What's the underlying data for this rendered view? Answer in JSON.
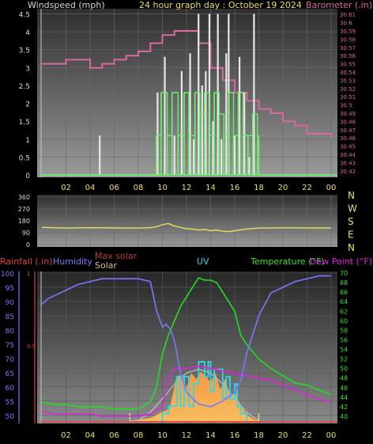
{
  "chart_data": [
    {
      "type": "line",
      "title": "24 hour graph day : October 19 2024",
      "y_left_label": "Windspeed (mph)",
      "y_right_label": "Barometer (.in)",
      "x_ticks": [
        "02",
        "04",
        "06",
        "08",
        "10",
        "12",
        "14",
        "16",
        "18",
        "20",
        "22",
        "00"
      ],
      "y_left_ticks": [
        "0",
        "0.5",
        "1",
        "1.5",
        "2",
        "2.5",
        "3",
        "3.5",
        "4",
        "4.5"
      ],
      "y_right_ticks": [
        "30.42",
        "30.43",
        "30.44",
        "30.45",
        "30.46",
        "30.47",
        "30.48",
        "30.49",
        "30.5",
        "30.51",
        "30.52",
        "30.53",
        "30.54",
        "30.55",
        "30.56",
        "30.57",
        "30.58",
        "30.59",
        "30.6",
        "30.61"
      ],
      "ylim_left": [
        0,
        4.6
      ],
      "ylim_right": [
        30.415,
        30.615
      ],
      "series": [
        {
          "name": "Barometer",
          "color": "#d86aa0",
          "x": [
            0,
            1,
            2,
            3,
            4,
            5,
            6,
            7,
            8,
            9,
            10,
            11,
            12,
            13,
            14,
            15,
            16,
            17,
            18,
            19,
            20,
            21,
            22,
            23,
            24
          ],
          "values": [
            30.55,
            30.55,
            30.555,
            30.555,
            30.545,
            30.55,
            30.555,
            30.56,
            30.565,
            30.575,
            30.585,
            30.59,
            30.59,
            30.575,
            30.545,
            30.53,
            30.515,
            30.505,
            30.495,
            30.49,
            30.48,
            30.475,
            30.465,
            30.465,
            30.46
          ]
        },
        {
          "name": "Wind gust",
          "color": "#e8e8e8",
          "x": [
            0,
            4.7,
            4.8,
            4.9,
            9.3,
            9.6,
            10.2,
            11.0,
            11.6,
            12.3,
            12.6,
            13.0,
            13.3,
            13.6,
            13.9,
            14.2,
            14.6,
            14.9,
            15.3,
            15.5,
            16.0,
            16.4,
            16.8,
            17.2,
            17.6,
            18.0,
            24
          ],
          "values": [
            0,
            0,
            1.1,
            0,
            0,
            2.3,
            3.3,
            1.1,
            2.9,
            3.4,
            1.0,
            4.5,
            2.5,
            2.9,
            4.5,
            1.5,
            4.5,
            1.0,
            3.4,
            4.5,
            1.1,
            3.3,
            2.3,
            0.5,
            4.5,
            0,
            0
          ]
        },
        {
          "name": "Windspeed",
          "color": "#6cf06c",
          "x": [
            0,
            9.3,
            9.5,
            9.9,
            10.4,
            10.8,
            11.3,
            11.8,
            12.2,
            12.7,
            13.1,
            13.5,
            13.9,
            14.3,
            14.7,
            15.1,
            15.5,
            15.9,
            16.3,
            16.7,
            17.1,
            17.5,
            17.9,
            18.0,
            24
          ],
          "values": [
            0,
            0,
            1.1,
            2.3,
            1.1,
            2.3,
            1.1,
            2.3,
            1.1,
            2.3,
            1.7,
            2.3,
            1.1,
            2.3,
            1.7,
            1.1,
            2.3,
            1.1,
            2.3,
            1.1,
            1.1,
            1.7,
            1.1,
            0,
            0
          ]
        }
      ]
    },
    {
      "type": "line",
      "y_ticks": [
        "360",
        "270",
        "180",
        "90",
        "0"
      ],
      "right_labels": [
        "N",
        "W",
        "S",
        "E",
        "N"
      ],
      "ylim": [
        0,
        360
      ],
      "series": [
        {
          "name": "Wind direction",
          "color": "#e8e060",
          "x": [
            0,
            2,
            4,
            6,
            8,
            9,
            9.5,
            10,
            10.5,
            11,
            11.5,
            12,
            12.5,
            13,
            13.5,
            14,
            14.5,
            15,
            15.5,
            16,
            16.5,
            17,
            17.5,
            18,
            20,
            22,
            24
          ],
          "values": [
            130,
            125,
            128,
            126,
            125,
            128,
            135,
            150,
            160,
            140,
            130,
            120,
            118,
            110,
            115,
            105,
            110,
            100,
            98,
            105,
            112,
            118,
            122,
            125,
            127,
            126,
            126
          ]
        }
      ]
    },
    {
      "type": "line",
      "left_labels": [
        "Rainfall (.in)",
        "Humidity"
      ],
      "center_labels": [
        "Max solar",
        "Solar"
      ],
      "uv_label": "UV",
      "right_labels": [
        "Temperature (°F)",
        "Dew Point (°F)"
      ],
      "x_ticks": [
        "02",
        "04",
        "06",
        "08",
        "10",
        "12",
        "14",
        "16",
        "18",
        "20",
        "22",
        "00"
      ],
      "y_left_ticks": [
        "50",
        "55",
        "60",
        "65",
        "70",
        "75",
        "80",
        "85",
        "90",
        "95",
        "100"
      ],
      "y_rain_ticks": [
        "0.5",
        "1"
      ],
      "y_right_ticks": [
        "40",
        "42",
        "44",
        "46",
        "48",
        "50",
        "52",
        "54",
        "56",
        "58",
        "60",
        "62",
        "64",
        "66",
        "68",
        "70"
      ],
      "ylim_humidity": [
        48,
        100
      ],
      "ylim_temperature": [
        39,
        70
      ],
      "series": [
        {
          "name": "Humidity",
          "color": "#7878ff",
          "x": [
            0,
            0.5,
            1,
            2,
            3,
            4,
            5,
            6,
            7,
            8,
            9,
            9.5,
            10,
            10.3,
            10.7,
            11,
            11.5,
            12,
            13,
            14,
            15,
            16,
            16.5,
            17,
            18,
            19,
            20,
            21,
            22,
            23,
            24
          ],
          "values": [
            89,
            91,
            92,
            94,
            96,
            97,
            98,
            98,
            98,
            98,
            97,
            87,
            81,
            82,
            80,
            76,
            65,
            58,
            54,
            53,
            55,
            58,
            62,
            72,
            85,
            93,
            95,
            97,
            98,
            99,
            99
          ]
        },
        {
          "name": "Temperature",
          "color": "#20e020",
          "x": [
            0,
            1,
            2,
            3,
            4,
            5,
            6,
            7,
            8,
            9,
            9.5,
            10,
            10.5,
            11,
            11.5,
            12,
            12.5,
            13,
            13.5,
            14,
            14.5,
            15,
            16,
            16.5,
            17,
            18,
            19,
            20,
            21,
            22,
            23,
            24
          ],
          "values": [
            43,
            42.5,
            42.5,
            42,
            42,
            42,
            41.5,
            41.5,
            41.5,
            43,
            46,
            53,
            57,
            60,
            63,
            65,
            67,
            69,
            68.5,
            68.5,
            68,
            66,
            62,
            57,
            55,
            52,
            50,
            48.5,
            47,
            46.5,
            45.5,
            44.5
          ]
        },
        {
          "name": "Dew Point",
          "color": "#e020e0",
          "x": [
            0,
            1,
            2,
            3,
            4,
            5,
            6,
            7,
            8,
            9,
            10,
            10.5,
            11,
            12,
            13,
            14,
            15,
            16,
            17,
            18,
            19,
            20,
            21,
            22,
            23,
            24
          ],
          "values": [
            41,
            40.5,
            40.5,
            40.5,
            40.5,
            40,
            40,
            40,
            40,
            40.5,
            42,
            48,
            50,
            50,
            50.5,
            50,
            49.5,
            49,
            48.5,
            48,
            47.5,
            46.5,
            45.5,
            44.5,
            43.5,
            43
          ]
        },
        {
          "name": "Max solar",
          "color": "#b8b8b8",
          "x": [
            7.3,
            8,
            9,
            10,
            11,
            12,
            13,
            14,
            15,
            16,
            17,
            18
          ],
          "values": [
            0,
            5,
            60,
            150,
            250,
            325,
            350,
            325,
            250,
            150,
            60,
            0
          ]
        },
        {
          "name": "Solar",
          "color": "#f0a040",
          "x": [
            7.3,
            9,
            10,
            10.6,
            10.8,
            11.2,
            11.6,
            12,
            12.4,
            12.8,
            13.2,
            13.6,
            14,
            14.4,
            14.8,
            15.2,
            15.6,
            16,
            16.4,
            16.8,
            17.2,
            17.6,
            18
          ],
          "values": [
            0,
            20,
            60,
            80,
            150,
            300,
            310,
            220,
            320,
            280,
            330,
            300,
            260,
            320,
            210,
            280,
            170,
            190,
            120,
            60,
            30,
            10,
            0
          ]
        },
        {
          "name": "UV",
          "color": "#30d8e8",
          "x": [
            9.8,
            10,
            10.5,
            11,
            11.2,
            11.5,
            11.8,
            12.2,
            12.6,
            13,
            13.2,
            13.5,
            13.8,
            14,
            14.3,
            14.6,
            15,
            15.3,
            15.6,
            16,
            16.2,
            16.5,
            17
          ],
          "values": [
            0,
            0.5,
            1,
            1,
            3,
            1,
            3,
            1,
            2.5,
            4,
            4,
            3,
            4,
            2,
            3.5,
            3.5,
            1.5,
            3,
            1.5,
            2.5,
            1,
            0.5,
            0
          ]
        }
      ]
    }
  ]
}
